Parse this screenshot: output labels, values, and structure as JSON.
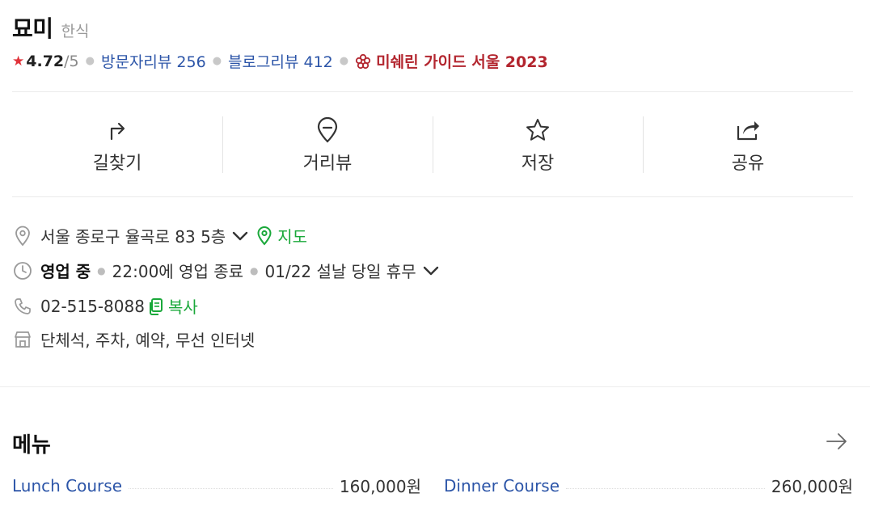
{
  "place": {
    "name": "묘미",
    "category": "한식"
  },
  "meta": {
    "rating": "4.72",
    "rating_max": "/5",
    "visitor_reviews": "방문자리뷰 256",
    "blog_reviews": "블로그리뷰 412",
    "michelin": "미쉐린 가이드 서울 2023"
  },
  "actions": [
    {
      "label": "길찾기",
      "icon": "directions-icon"
    },
    {
      "label": "거리뷰",
      "icon": "street-view-pin-icon"
    },
    {
      "label": "저장",
      "icon": "star-outline-icon"
    },
    {
      "label": "공유",
      "icon": "share-icon"
    }
  ],
  "info": {
    "address": "서울 종로구 율곡로 83 5층",
    "map_link": "지도",
    "status": "영업 중",
    "closing": "22:00에 영업 종료",
    "notice": "01/22 설날 당일 휴무",
    "phone": "02-515-8088",
    "copy_label": "복사",
    "amenities": "단체석, 주차, 예약, 무선 인터넷"
  },
  "menu": {
    "title": "메뉴",
    "items": [
      {
        "name": "Lunch Course",
        "price": "160,000원"
      },
      {
        "name": "Dinner Course",
        "price": "260,000원"
      }
    ]
  },
  "colors": {
    "accent_blue": "#2c55a8",
    "accent_green": "#1aa83a",
    "michelin_red": "#b3262f",
    "star_red": "#e0323a"
  }
}
